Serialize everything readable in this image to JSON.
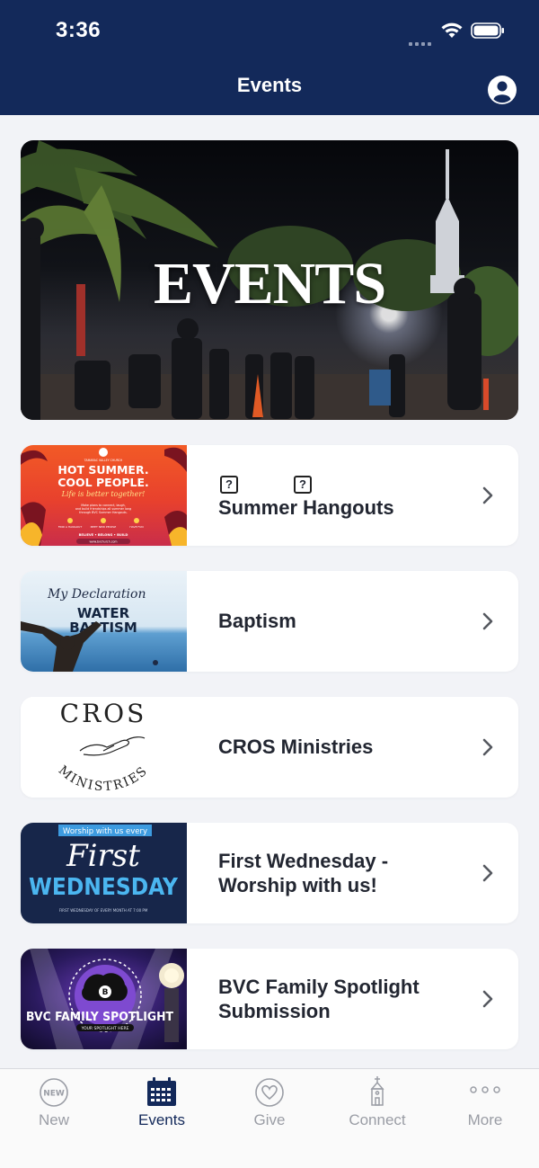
{
  "status_bar": {
    "time": "3:36"
  },
  "header": {
    "title": "Events"
  },
  "hero": {
    "title": "EVENTS"
  },
  "events": [
    {
      "title": "Summer Hangouts",
      "thumb": {
        "church": "TAMARAC VALLEY CHURCH",
        "line1": "HOT SUMMER.",
        "line2": "COOL PEOPLE.",
        "line3": "Life is better together!",
        "blurb": "Make plans to connect, laugh, and build friendships all summer long through BVC Summer Hangouts.",
        "icons": [
          "FIND A HANGOUT",
          "MEET NEW PEOPLE",
          "HAVE FUN"
        ],
        "motto": "BELIEVE • BELONG • BUILD",
        "url": "www.bvchurch.com"
      }
    },
    {
      "title": "Baptism",
      "thumb": {
        "line1": "My Declaration",
        "line2": "WATER",
        "line3": "BAPTISM"
      }
    },
    {
      "title": "CROS Ministries",
      "thumb": {
        "top": "CROS",
        "bottom": "MINISTRIES"
      }
    },
    {
      "title": "First Wednesday - Worship with us!",
      "title_line1": "First Wednesday -",
      "title_line2": "Worship with us!",
      "thumb": {
        "banner": "Worship with us every",
        "line1": "First",
        "line2": "WEDNESDAY",
        "footer": "FIRST WEDNESDAY OF EVERY MONTH AT 7:00 PM"
      }
    },
    {
      "title": "BVC Family Spotlight Submission",
      "title_line1": "BVC Family Spotlight",
      "title_line2": "Submission",
      "thumb": {
        "line1": "BVC FAMILY SPOTLIGHT",
        "line2": "YOUR SPOTLIGHT HERE"
      }
    }
  ],
  "tabbar": {
    "active": "Events",
    "tabs": [
      {
        "label": "New",
        "icon": "new-badge-icon",
        "badge": "NEW"
      },
      {
        "label": "Events",
        "icon": "calendar-icon"
      },
      {
        "label": "Give",
        "icon": "heart-icon"
      },
      {
        "label": "Connect",
        "icon": "church-icon"
      },
      {
        "label": "More",
        "icon": "more-dots-icon"
      }
    ]
  },
  "colors": {
    "header_bg": "#13295a",
    "active_tab": "#13295a",
    "inactive_tab": "#9a9da5"
  }
}
